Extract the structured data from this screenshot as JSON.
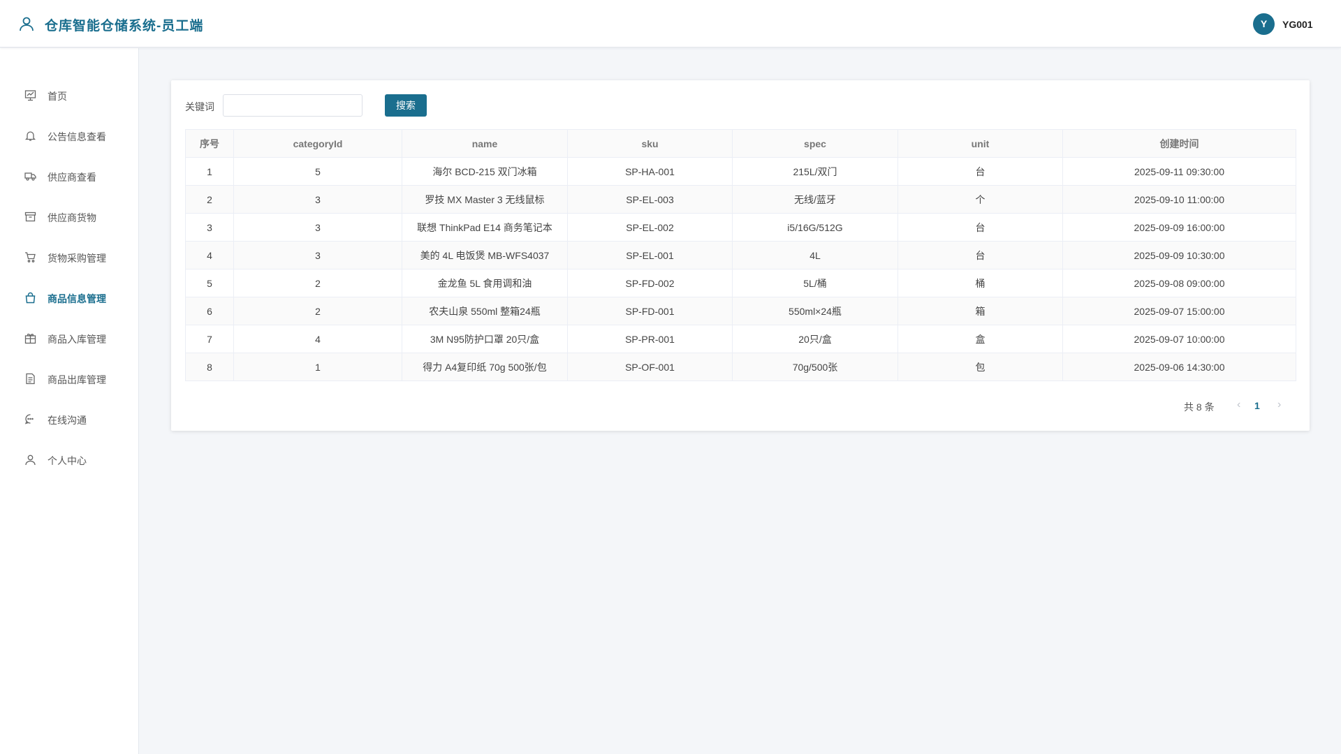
{
  "app": {
    "title": "仓库智能仓储系统-员工端",
    "user_initial": "Y",
    "username": "YG001"
  },
  "sidebar": {
    "items": [
      {
        "label": "首页",
        "icon": "home-chart-icon"
      },
      {
        "label": "公告信息查看",
        "icon": "bell-icon"
      },
      {
        "label": "供应商查看",
        "icon": "truck-icon"
      },
      {
        "label": "供应商货物",
        "icon": "box-icon"
      },
      {
        "label": "货物采购管理",
        "icon": "cart-icon"
      },
      {
        "label": "商品信息管理",
        "icon": "bag-icon",
        "active": true
      },
      {
        "label": "商品入库管理",
        "icon": "gift-icon"
      },
      {
        "label": "商品出库管理",
        "icon": "document-icon"
      },
      {
        "label": "在线沟通",
        "icon": "chat-icon"
      },
      {
        "label": "个人中心",
        "icon": "user-icon"
      }
    ]
  },
  "search": {
    "label": "关键词",
    "value": "",
    "placeholder": "",
    "button_label": "搜索"
  },
  "table": {
    "columns": [
      "序号",
      "categoryId",
      "name",
      "sku",
      "spec",
      "unit",
      "创建时间"
    ],
    "rows": [
      [
        "1",
        "5",
        "海尔 BCD-215 双门冰箱",
        "SP-HA-001",
        "215L/双门",
        "台",
        "2025-09-11 09:30:00"
      ],
      [
        "2",
        "3",
        "罗技 MX Master 3 无线鼠标",
        "SP-EL-003",
        "无线/蓝牙",
        "个",
        "2025-09-10 11:00:00"
      ],
      [
        "3",
        "3",
        "联想 ThinkPad E14 商务笔记本",
        "SP-EL-002",
        "i5/16G/512G",
        "台",
        "2025-09-09 16:00:00"
      ],
      [
        "4",
        "3",
        "美的 4L 电饭煲 MB-WFS4037",
        "SP-EL-001",
        "4L",
        "台",
        "2025-09-09 10:30:00"
      ],
      [
        "5",
        "2",
        "金龙鱼 5L 食用调和油",
        "SP-FD-002",
        "5L/桶",
        "桶",
        "2025-09-08 09:00:00"
      ],
      [
        "6",
        "2",
        "农夫山泉 550ml 整箱24瓶",
        "SP-FD-001",
        "550ml×24瓶",
        "箱",
        "2025-09-07 15:00:00"
      ],
      [
        "7",
        "4",
        "3M N95防护口罩 20只/盒",
        "SP-PR-001",
        "20只/盒",
        "盒",
        "2025-09-07 10:00:00"
      ],
      [
        "8",
        "1",
        "得力 A4复印纸 70g 500张/包",
        "SP-OF-001",
        "70g/500张",
        "包",
        "2025-09-06 14:30:00"
      ]
    ]
  },
  "pagination": {
    "total_text": "共 8 条",
    "current_page": "1",
    "prev": "‹",
    "next": "›"
  },
  "colors": {
    "accent": "#1a6e8e",
    "background": "#f4f6f9"
  }
}
